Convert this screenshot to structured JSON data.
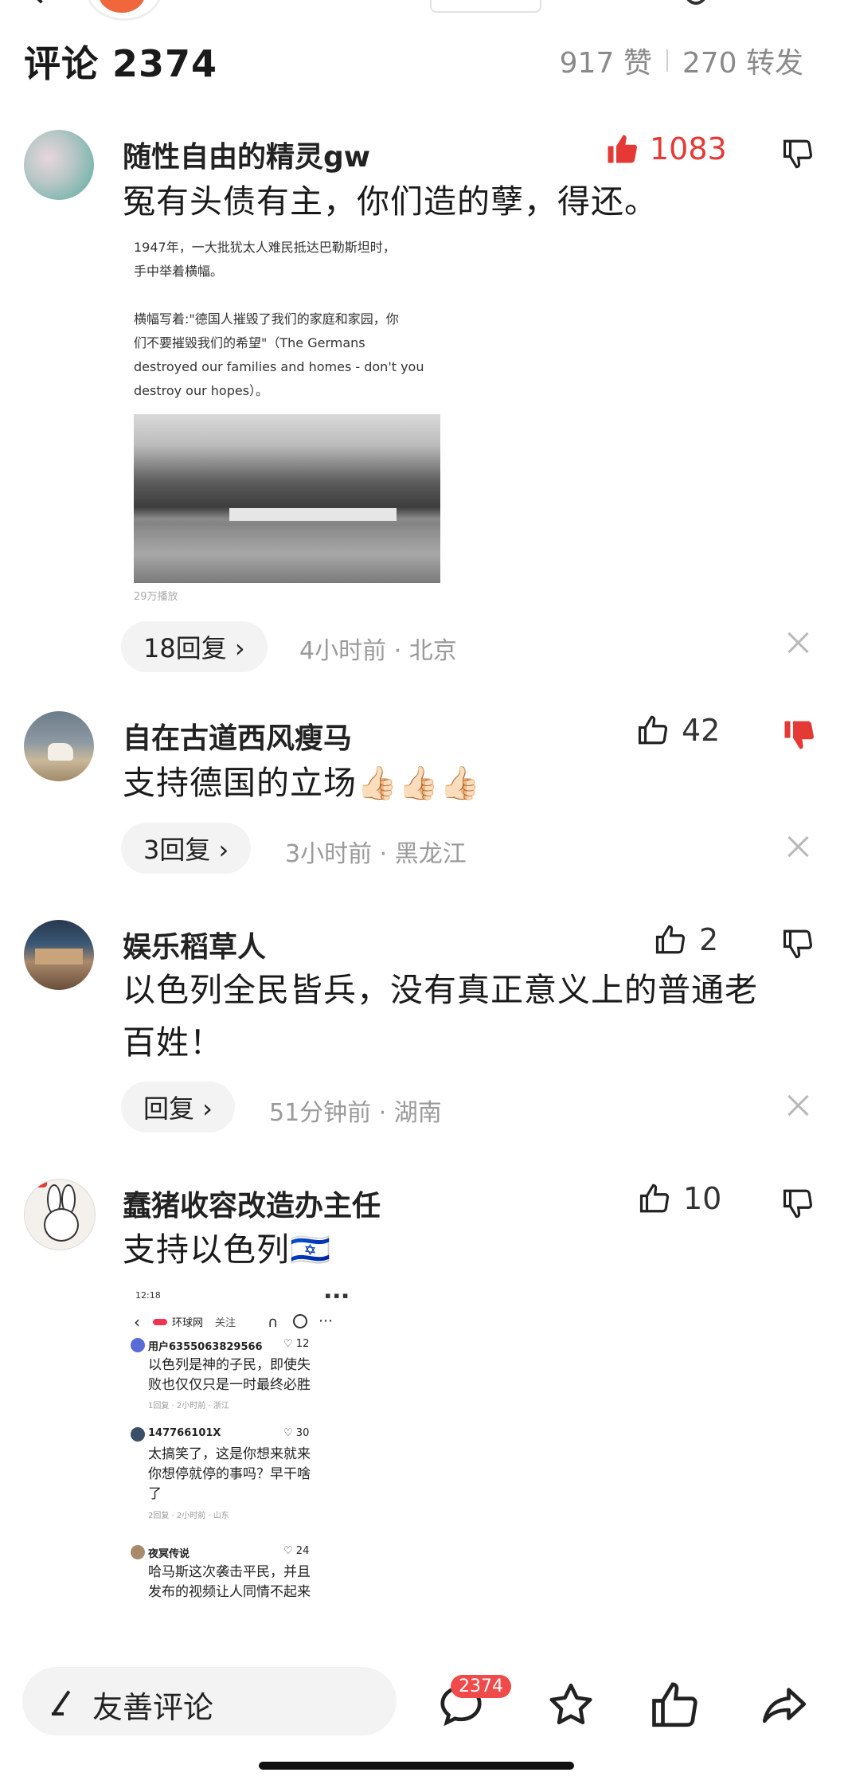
{
  "header": {
    "title": "评论 2374",
    "likes": "917 赞",
    "shares": "270 转发"
  },
  "comments": [
    {
      "user": "随性自由的精灵gw",
      "text": "冤有头债有主，你们造的孽，得还。",
      "likes": "1083",
      "liked": true,
      "reply": "18回复 ›",
      "meta": "4小时前 · 北京",
      "image": {
        "lines": [
          "1947年，一大批犹太人难民抵达巴勒斯坦时，",
          "手中举着横幅。",
          "",
          "横幅写着:\"德国人摧毁了我们的家庭和家园，你",
          "们不要摧毁我们的希望\"（The Germans",
          "destroyed our families and homes - don't you",
          "destroy our hopes）。"
        ],
        "views": "29万播放"
      }
    },
    {
      "user": "自在古道西风瘦马",
      "text": "支持德国的立场👍🏻👍🏻👍🏻",
      "likes": "42",
      "disliked": true,
      "reply": "3回复 ›",
      "meta": "3小时前 · 黑龙江"
    },
    {
      "user": "娱乐稻草人",
      "text_lines": [
        "以色列全民皆兵，没有真正意义上的普通老",
        "百姓！"
      ],
      "likes": "2",
      "reply": "回复 ›",
      "meta": "51分钟前 · 湖南"
    },
    {
      "user": "蠢猪收容改造办主任",
      "text": "支持以色列🇮🇱",
      "likes": "10",
      "screenshot": {
        "time": "12:18",
        "source": "环球网",
        "follow": "关注",
        "items": [
          {
            "user": "用户6355063829566",
            "likes": "12",
            "lines": [
              "以色列是神的子民，即使失",
              "败也仅仅只是一时最终必胜"
            ],
            "meta": "1回复 · 2小时前 · 浙江"
          },
          {
            "user": "147766101X",
            "likes": "30",
            "lines": [
              "太搞笑了，这是你想来就来",
              "你想停就停的事吗？早干啥",
              "了"
            ],
            "meta": "2回复 · 2小时前 · 山东"
          },
          {
            "user": "夜冥传说",
            "likes": "24",
            "lines": [
              "哈马斯这次袭击平民，并且",
              "发布的视频让人同情不起来"
            ]
          }
        ]
      }
    }
  ],
  "bottom": {
    "placeholder": "友善评论",
    "comment_count": "2374"
  }
}
